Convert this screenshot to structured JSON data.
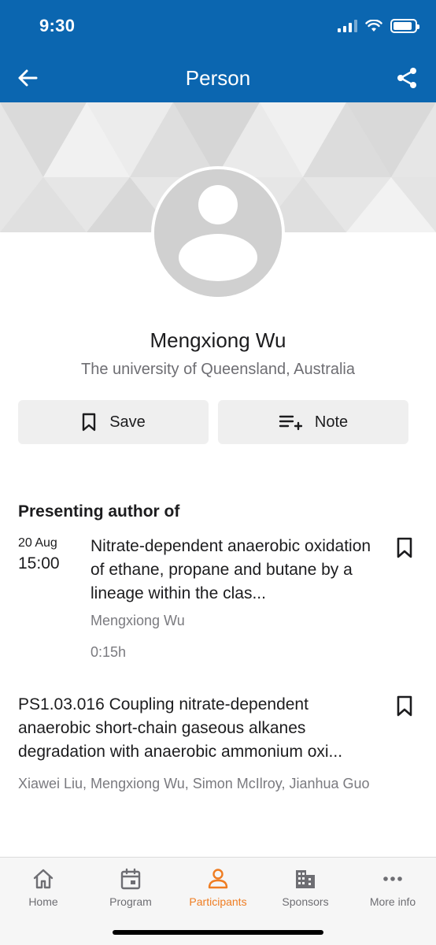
{
  "status_bar": {
    "time": "9:30",
    "battery_level": 0.9
  },
  "header": {
    "title": "Person"
  },
  "person": {
    "name": "Mengxiong Wu",
    "affiliation": "The university of Queensland, Australia"
  },
  "actions": {
    "save_label": "Save",
    "note_label": "Note"
  },
  "section": {
    "title": "Presenting author of"
  },
  "sessions": [
    {
      "date": "20 Aug",
      "time": "15:00",
      "title": "Nitrate-dependent anaerobic oxidation of ethane, propane and butane by a lineage within the clas...",
      "authors": "Mengxiong Wu",
      "duration": "0:15h"
    },
    {
      "title": "PS1.03.016 Coupling nitrate-dependent anaerobic short-chain gaseous alkanes degradation with anaerobic ammonium oxi...",
      "authors": "Xiawei Liu, Mengxiong Wu, Simon McIlroy, Jianhua Guo"
    }
  ],
  "tabs": [
    {
      "label": "Home",
      "icon": "home-icon"
    },
    {
      "label": "Program",
      "icon": "calendar-icon"
    },
    {
      "label": "Participants",
      "icon": "person-icon",
      "active": true
    },
    {
      "label": "Sponsors",
      "icon": "building-icon"
    },
    {
      "label": "More info",
      "icon": "more-icon"
    }
  ],
  "colors": {
    "header_bg": "#0b66b0",
    "accent": "#ef7d22"
  }
}
